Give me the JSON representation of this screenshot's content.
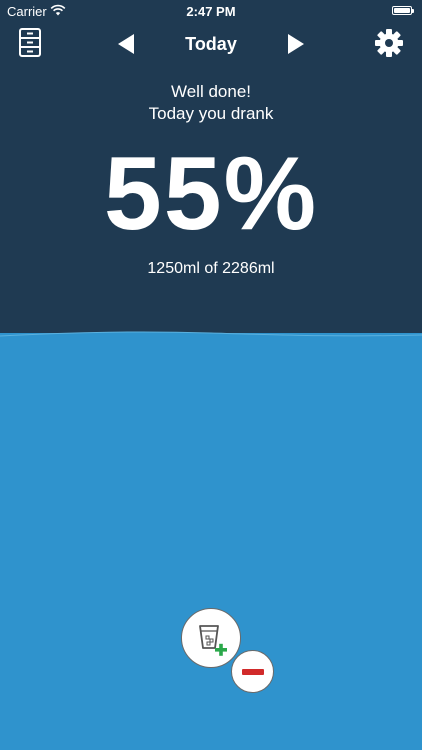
{
  "status_bar": {
    "carrier": "Carrier",
    "time": "2:47 PM"
  },
  "nav": {
    "title": "Today",
    "left_icon": "cabinet-icon",
    "prev_icon": "triangle-left-icon",
    "next_icon": "triangle-right-icon",
    "right_icon": "gear-icon"
  },
  "summary": {
    "message_line1": "Well done!",
    "message_line2": "Today you drank",
    "percent": "55%",
    "amount": "1250ml of 2286ml",
    "progress_fraction": 0.55
  },
  "actions": {
    "add_icon": "glass-plus-icon",
    "remove_icon": "minus-icon"
  },
  "colors": {
    "header_bg": "#1f3a52",
    "water": "#2f93cd",
    "add_accent": "#2aa84a",
    "remove_accent": "#d12a2a"
  }
}
